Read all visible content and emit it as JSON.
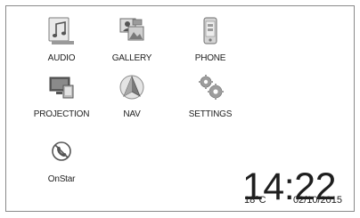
{
  "apps": [
    {
      "id": "audio",
      "label": "AUDIO",
      "icon": "audio-icon"
    },
    {
      "id": "gallery",
      "label": "GALLERY",
      "icon": "gallery-icon"
    },
    {
      "id": "phone",
      "label": "PHONE",
      "icon": "phone-icon"
    },
    {
      "id": "projection",
      "label": "PROJECTION",
      "icon": "projection-icon"
    },
    {
      "id": "nav",
      "label": "NAV",
      "icon": "nav-icon"
    },
    {
      "id": "settings",
      "label": "SETTINGS",
      "icon": "settings-icon"
    },
    {
      "id": "onstar",
      "label": "OnStar",
      "icon": "onstar-icon"
    }
  ],
  "status": {
    "time": "14:22",
    "temperature": "18°C",
    "date": "02/10/2015"
  }
}
